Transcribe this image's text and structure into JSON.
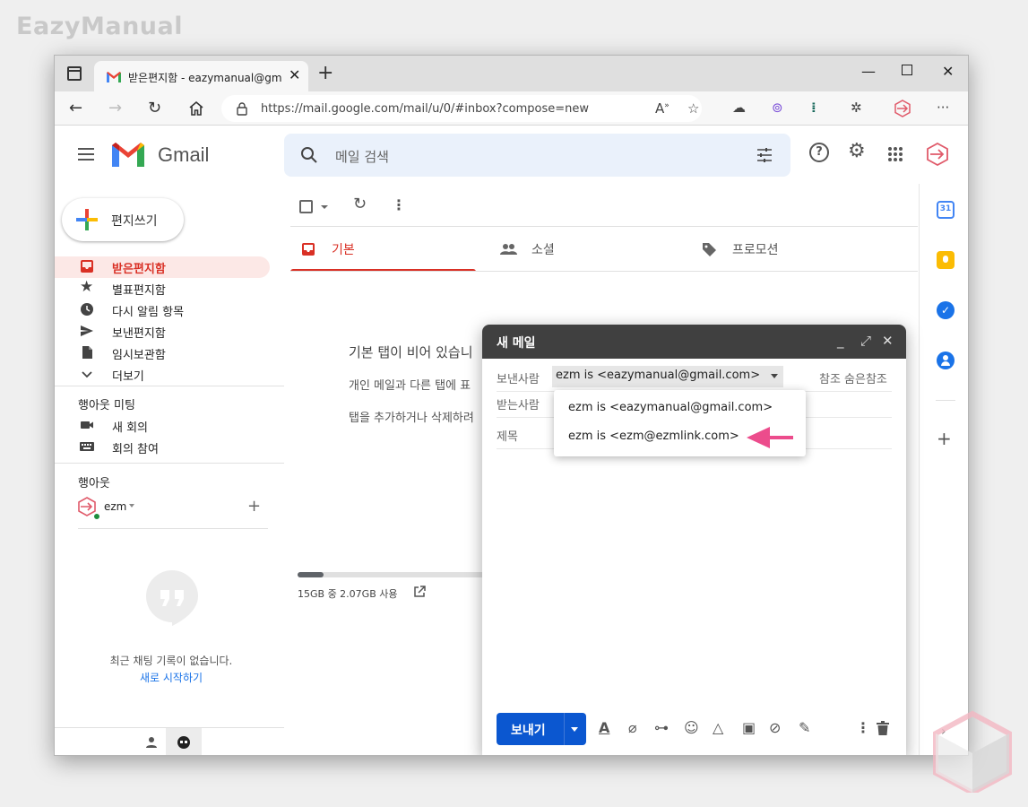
{
  "watermark": "EazyManual",
  "browser": {
    "tab_title": "받은편지함 - eazymanual@gmail.com",
    "url": "https://mail.google.com/mail/u/0/#inbox?compose=new"
  },
  "gmail": {
    "brand": "Gmail",
    "search_placeholder": "메일 검색"
  },
  "sidebar": {
    "compose_label": "편지쓰기",
    "items": [
      {
        "label": "받은편지함",
        "icon": "inbox-icon"
      },
      {
        "label": "별표편지함",
        "icon": "star-icon"
      },
      {
        "label": "다시 알림 항목",
        "icon": "clock-icon"
      },
      {
        "label": "보낸편지함",
        "icon": "send-icon"
      },
      {
        "label": "임시보관함",
        "icon": "file-icon"
      },
      {
        "label": "더보기",
        "icon": "chevron-down-icon"
      }
    ],
    "meet_title": "행아웃 미팅",
    "meet_items": [
      {
        "label": "새 회의",
        "icon": "video-icon"
      },
      {
        "label": "회의 참여",
        "icon": "keyboard-icon"
      }
    ],
    "hangouts_title": "행아웃",
    "user_name": "ezm",
    "no_chat": "최근 채팅 기록이 없습니다.",
    "start_new": "새로 시작하기"
  },
  "main": {
    "tabs": [
      {
        "label": "기본",
        "icon": "inbox-icon"
      },
      {
        "label": "소셜",
        "icon": "people-icon"
      },
      {
        "label": "프로모션",
        "icon": "tag-icon"
      }
    ],
    "empty_title": "기본 탭이 비어 있습니",
    "empty_line1": "개인 메일과 다른 탭에 표",
    "empty_line2": "탭을 추가하거나 삭제하려",
    "storage_text": "15GB 중 2.07GB 사용",
    "storage_fraction": 0.138
  },
  "compose": {
    "title": "새 메일",
    "from_label": "보낸사람",
    "from_value": "ezm is <eazymanual@gmail.com>",
    "cc_bcc": "참조 숨은참조",
    "to_label": "받는사람",
    "subject_label": "제목",
    "from_options": [
      "ezm is <eazymanual@gmail.com>",
      "ezm is <ezm@ezmlink.com>"
    ],
    "send_label": "보내기"
  },
  "colors": {
    "accent_red": "#d93025",
    "send_blue": "#0b57d0",
    "arrow_pink": "#ec4c8c"
  }
}
